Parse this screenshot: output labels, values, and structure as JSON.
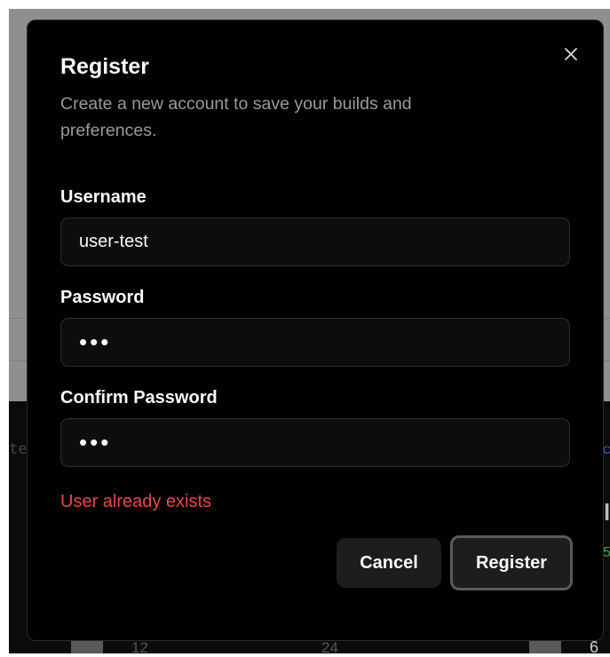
{
  "background": {
    "left_text": "te",
    "right_glyph": "l",
    "right_green": "5",
    "right_blue": "C",
    "ticks": [
      "12",
      "24",
      "6"
    ]
  },
  "dialog": {
    "title": "Register",
    "subtitle": "Create a new account to save your builds and preferences.",
    "close_icon": "close-icon",
    "username": {
      "label": "Username",
      "value": "user-test"
    },
    "password": {
      "label": "Password",
      "value": "•••"
    },
    "confirm_password": {
      "label": "Confirm Password",
      "value": "•••"
    },
    "error": "User already exists",
    "cancel_label": "Cancel",
    "register_label": "Register"
  },
  "colors": {
    "error": "#e5484d",
    "modal_bg": "#000000",
    "overlay_bg": "#8f8f8f"
  }
}
